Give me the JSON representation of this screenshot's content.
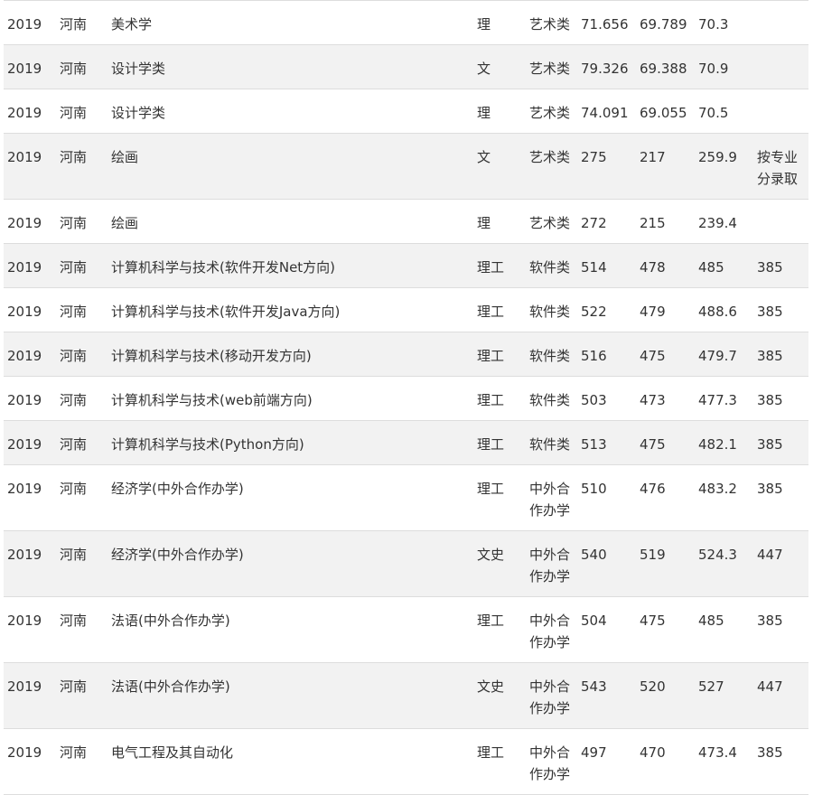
{
  "rows": [
    {
      "year": "2019",
      "province": "河南",
      "major": "美术学",
      "subject": "理",
      "batch": "艺术类",
      "max": "71.656",
      "min": "69.789",
      "avg": "70.3",
      "control": ""
    },
    {
      "year": "2019",
      "province": "河南",
      "major": "设计学类",
      "subject": "文",
      "batch": "艺术类",
      "max": "79.326",
      "min": "69.388",
      "avg": "70.9",
      "control": ""
    },
    {
      "year": "2019",
      "province": "河南",
      "major": "设计学类",
      "subject": "理",
      "batch": "艺术类",
      "max": "74.091",
      "min": "69.055",
      "avg": "70.5",
      "control": ""
    },
    {
      "year": "2019",
      "province": "河南",
      "major": "绘画",
      "subject": "文",
      "batch": "艺术类",
      "max": "275",
      "min": "217",
      "avg": "259.9",
      "control": "按专业分录取"
    },
    {
      "year": "2019",
      "province": "河南",
      "major": "绘画",
      "subject": "理",
      "batch": "艺术类",
      "max": "272",
      "min": "215",
      "avg": "239.4",
      "control": ""
    },
    {
      "year": "2019",
      "province": "河南",
      "major": "计算机科学与技术(软件开发Net方向)",
      "subject": "理工",
      "batch": "软件类",
      "max": "514",
      "min": "478",
      "avg": "485",
      "control": "385"
    },
    {
      "year": "2019",
      "province": "河南",
      "major": "计算机科学与技术(软件开发Java方向)",
      "subject": "理工",
      "batch": "软件类",
      "max": "522",
      "min": "479",
      "avg": "488.6",
      "control": "385"
    },
    {
      "year": "2019",
      "province": "河南",
      "major": "计算机科学与技术(移动开发方向)",
      "subject": "理工",
      "batch": "软件类",
      "max": "516",
      "min": "475",
      "avg": "479.7",
      "control": "385"
    },
    {
      "year": "2019",
      "province": "河南",
      "major": "计算机科学与技术(web前端方向)",
      "subject": "理工",
      "batch": "软件类",
      "max": "503",
      "min": "473",
      "avg": "477.3",
      "control": "385"
    },
    {
      "year": "2019",
      "province": "河南",
      "major": "计算机科学与技术(Python方向)",
      "subject": "理工",
      "batch": "软件类",
      "max": "513",
      "min": "475",
      "avg": "482.1",
      "control": "385"
    },
    {
      "year": "2019",
      "province": "河南",
      "major": "经济学(中外合作办学)",
      "subject": "理工",
      "batch": "中外合作办学",
      "max": "510",
      "min": "476",
      "avg": "483.2",
      "control": "385"
    },
    {
      "year": "2019",
      "province": "河南",
      "major": "经济学(中外合作办学)",
      "subject": "文史",
      "batch": "中外合作办学",
      "max": "540",
      "min": "519",
      "avg": "524.3",
      "control": "447"
    },
    {
      "year": "2019",
      "province": "河南",
      "major": "法语(中外合作办学)",
      "subject": "理工",
      "batch": "中外合作办学",
      "max": "504",
      "min": "475",
      "avg": "485",
      "control": "385"
    },
    {
      "year": "2019",
      "province": "河南",
      "major": "法语(中外合作办学)",
      "subject": "文史",
      "batch": "中外合作办学",
      "max": "543",
      "min": "520",
      "avg": "527",
      "control": "447"
    },
    {
      "year": "2019",
      "province": "河南",
      "major": "电气工程及其自动化",
      "subject": "理工",
      "batch": "中外合作办学",
      "max": "497",
      "min": "470",
      "avg": "473.4",
      "control": "385"
    }
  ]
}
